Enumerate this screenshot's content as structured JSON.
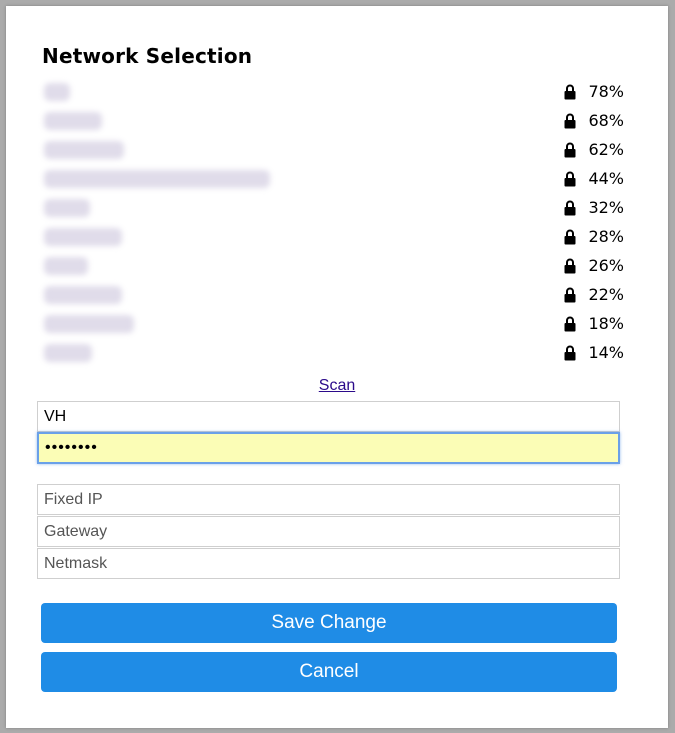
{
  "title": "Network Selection",
  "networks": [
    {
      "signal": "78%",
      "secured": true
    },
    {
      "signal": "68%",
      "secured": true
    },
    {
      "signal": "62%",
      "secured": true
    },
    {
      "signal": "44%",
      "secured": true
    },
    {
      "signal": "32%",
      "secured": true
    },
    {
      "signal": "28%",
      "secured": true
    },
    {
      "signal": "26%",
      "secured": true
    },
    {
      "signal": "22%",
      "secured": true
    },
    {
      "signal": "18%",
      "secured": true
    },
    {
      "signal": "14%",
      "secured": true
    }
  ],
  "scan_label": "Scan",
  "form": {
    "ssid_value": "VH",
    "password_value": "••••••••",
    "fixed_ip_placeholder": "Fixed IP",
    "gateway_placeholder": "Gateway",
    "netmask_placeholder": "Netmask"
  },
  "buttons": {
    "save_label": "Save Change",
    "cancel_label": "Cancel"
  },
  "icons": {
    "secured": "lock-icon"
  },
  "colors": {
    "button": "#1f8ce6",
    "link": "#2b0a8a",
    "password_bg": "#fbfdb6"
  }
}
